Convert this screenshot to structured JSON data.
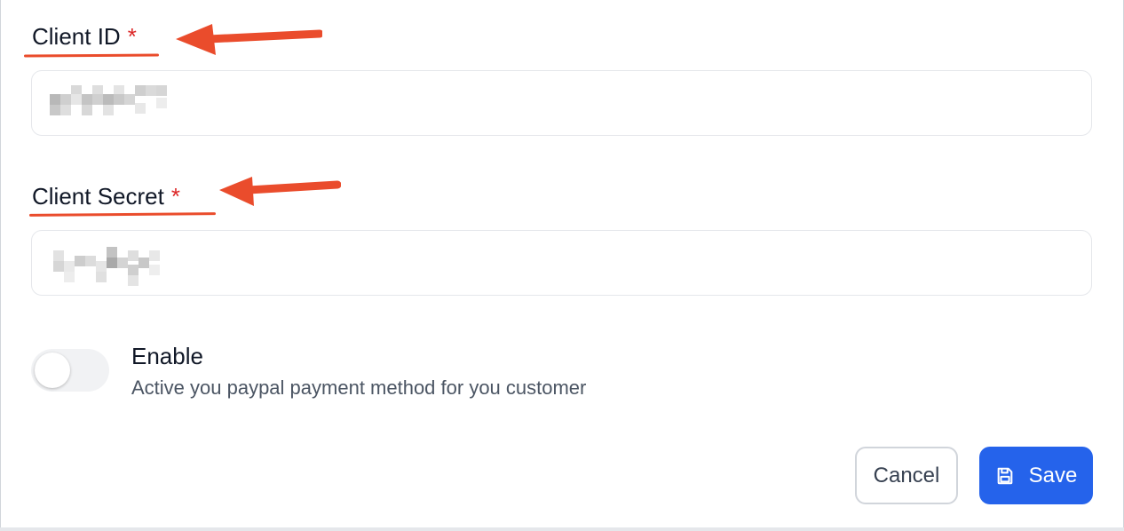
{
  "form": {
    "client_id": {
      "label": "Client ID",
      "required_mark": "*"
    },
    "client_secret": {
      "label": "Client Secret",
      "required_mark": "*"
    },
    "enable": {
      "title": "Enable",
      "description": "Active you paypal payment method for you customer",
      "on": false
    }
  },
  "actions": {
    "cancel_label": "Cancel",
    "save_label": "Save"
  },
  "colors": {
    "accent": "#2563eb",
    "annotation": "#ea4c2c",
    "required": "#dc2626"
  }
}
